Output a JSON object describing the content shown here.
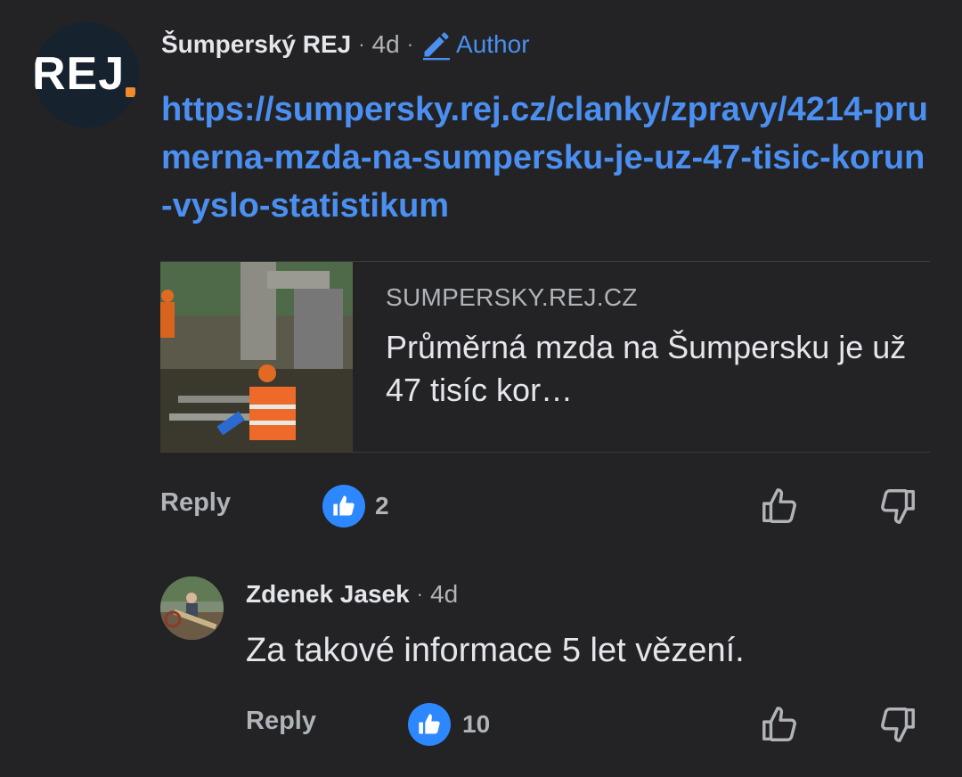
{
  "comment": {
    "author": "Šumperský REJ",
    "time": "4d",
    "author_badge": "Author",
    "avatar_logo": "REJ",
    "link": "https://sumpersky.rej.cz/clanky/zpravy/4214-prumerna-mzda-na-sumpersku-je-uz-47-tisic-korun-vyslo-statistikum",
    "preview": {
      "domain": "SUMPERSKY.REJ.CZ",
      "title": "Průměrná mzda na Šumpersku je už 47 tisíc kor…"
    },
    "actions": {
      "reply_label": "Reply",
      "like_count": "2"
    }
  },
  "reply": {
    "author": "Zdenek Jasek",
    "time": "4d",
    "text": "Za takové informace 5 let vězení.",
    "actions": {
      "reply_label": "Reply",
      "like_count": "10"
    }
  },
  "colors": {
    "background": "#232325",
    "link": "#4b8ff0",
    "like_badge": "#2d88ff",
    "logo_dot": "#f08a2b"
  },
  "icons": [
    "pencil-icon",
    "thumbs-up-badge-icon",
    "thumbs-up-icon",
    "thumbs-down-icon"
  ]
}
